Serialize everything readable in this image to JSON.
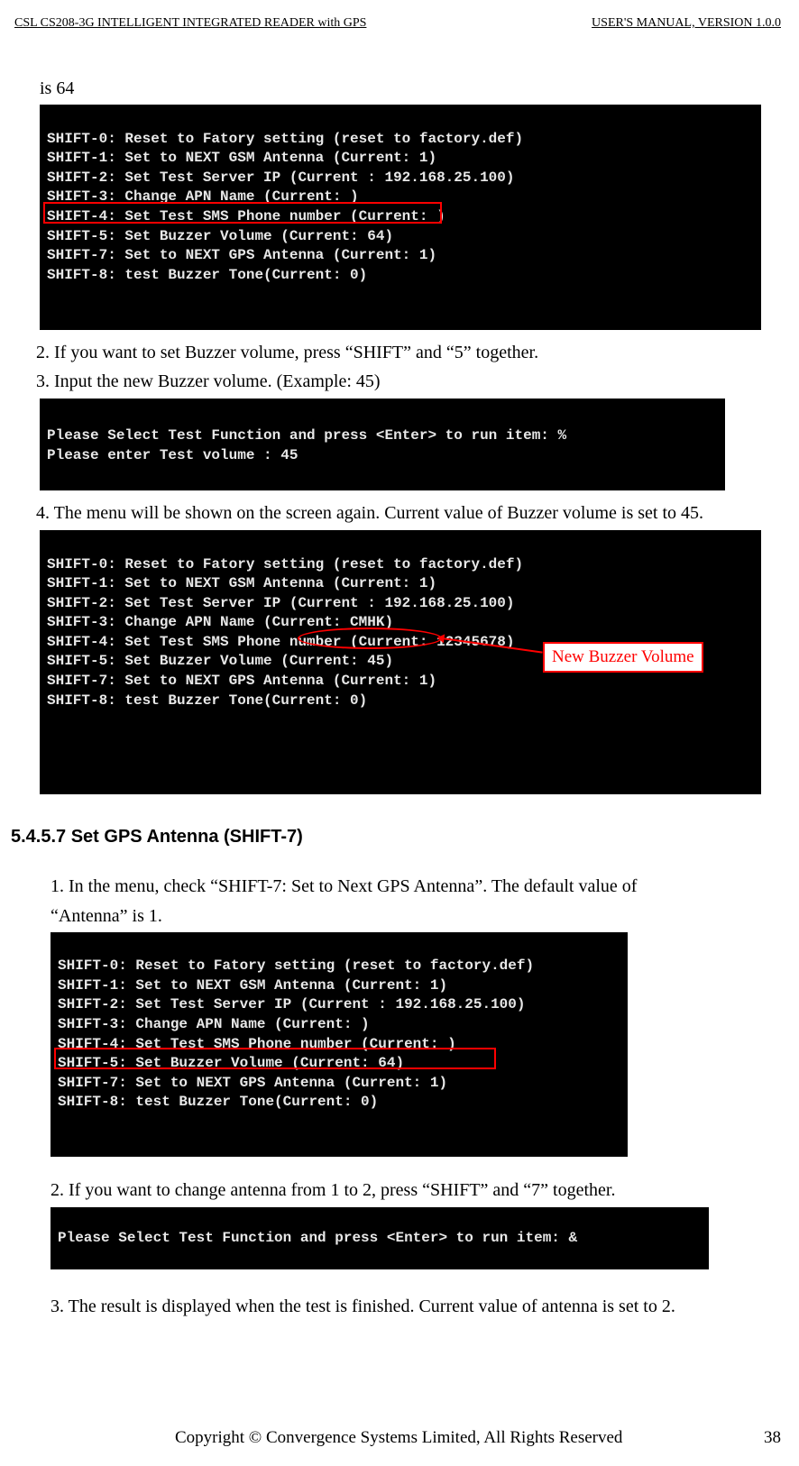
{
  "header": {
    "left": "CSL CS208-3G INTELLIGENT INTEGRATED READER with GPS",
    "right": "USER'S  MANUAL,  VERSION  1.0.0"
  },
  "intro_text": "is 64",
  "terminal1": {
    "lines": [
      "SHIFT-0: Reset to Fatory setting (reset to factory.def)",
      "SHIFT-1: Set to NEXT GSM Antenna (Current: 1)",
      "SHIFT-2: Set Test Server IP (Current : 192.168.25.100)",
      "SHIFT-3: Change APN Name (Current: )",
      "SHIFT-4: Set Test SMS Phone number (Current: )",
      "SHIFT-5: Set Buzzer Volume (Current: 64)",
      "SHIFT-7: Set to NEXT GPS Antenna (Current: 1)",
      "SHIFT-8: test Buzzer Tone(Current: 0)"
    ]
  },
  "step2": "2.  If you want to set Buzzer volume, press “SHIFT” and “5” together.",
  "step3": "3.  Input the new Buzzer volume. (Example: 45)",
  "terminal2": {
    "lines": [
      "Please Select Test Function and press <Enter> to run item: %",
      "Please enter Test volume : 45"
    ]
  },
  "step4": "4.  The menu will be shown on the screen again. Current value of Buzzer volume is set to 45.",
  "terminal3": {
    "lines": [
      "SHIFT-0: Reset to Fatory setting (reset to factory.def)",
      "SHIFT-1: Set to NEXT GSM Antenna (Current: 1)",
      "SHIFT-2: Set Test Server IP (Current : 192.168.25.100)",
      "SHIFT-3: Change APN Name (Current: CMHK)",
      "SHIFT-4: Set Test SMS Phone number (Current: 12345678)",
      "SHIFT-5: Set Buzzer Volume (Current: 45)",
      "SHIFT-7: Set to NEXT GPS Antenna (Current: 1)",
      "SHIFT-8: test Buzzer Tone(Current: 0)"
    ]
  },
  "annotation_label": "New Buzzer Volume",
  "section_heading": "5.4.5.7     Set GPS Antenna (SHIFT-7)",
  "gps_step1a": "1.      In the menu, check “SHIFT-7: Set to Next GPS Antenna”. The default value of",
  "gps_step1b": "“Antenna” is 1.",
  "terminal4": {
    "lines": [
      "SHIFT-0: Reset to Fatory setting (reset to factory.def)",
      "SHIFT-1: Set to NEXT GSM Antenna (Current: 1)",
      "SHIFT-2: Set Test Server IP (Current : 192.168.25.100)",
      "SHIFT-3: Change APN Name (Current: )",
      "SHIFT-4: Set Test SMS Phone number (Current: )",
      "SHIFT-5: Set Buzzer Volume (Current: 64)",
      "SHIFT-7: Set to NEXT GPS Antenna (Current: 1)",
      "SHIFT-8: test Buzzer Tone(Current: 0)"
    ]
  },
  "gps_step2": "2.      If you want to change antenna from 1 to 2, press “SHIFT” and “7” together.",
  "terminal5": {
    "lines": [
      "Please Select Test Function and press <Enter> to run item: &"
    ]
  },
  "gps_step3": "3.      The result is displayed when the test is finished. Current value of antenna is set to 2.",
  "footer": {
    "copyright": "Copyright © Convergence Systems Limited, All Rights Reserved",
    "page": "38"
  }
}
